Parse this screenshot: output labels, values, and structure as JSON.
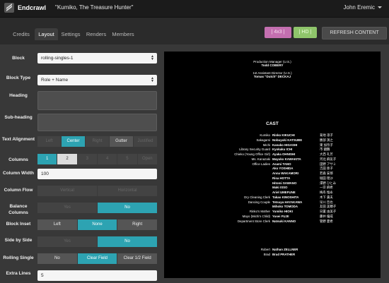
{
  "app": {
    "brand": "Endcrawl",
    "project": "\"Kumiko, The Treasure Hunter\"",
    "user": "John Eremic"
  },
  "tabs": [
    "Credits",
    "Layout",
    "Settings",
    "Renders",
    "Members"
  ],
  "active_tab": "Layout",
  "toolbar": {
    "ratio43": "| 4x3 |",
    "hd": "| HD |",
    "refresh": "REFRESH CONTENT"
  },
  "form": {
    "block": {
      "label": "Block",
      "value": "rolling-singles-1"
    },
    "block_type": {
      "label": "Block Type",
      "value": "Role + Name"
    },
    "heading": {
      "label": "Heading"
    },
    "subheading": {
      "label": "Sub-heading"
    },
    "text_alignment": {
      "label": "Text Alignment",
      "options": [
        "Left",
        "Center",
        "Right",
        "Gutter",
        "Justified"
      ],
      "selected": "Center"
    },
    "columns": {
      "label": "Columns",
      "options": [
        "1",
        "2",
        "3",
        "4",
        "5",
        "Open"
      ],
      "selected": "1"
    },
    "column_width": {
      "label": "Column Width",
      "value": "100"
    },
    "column_flow": {
      "label": "Column Flow",
      "options": [
        "Vertical",
        "Horizontal"
      ]
    },
    "balance_columns": {
      "label": "Balance Columns",
      "options": [
        "Yes",
        "No"
      ],
      "selected": "No"
    },
    "block_inset": {
      "label": "Block Inset",
      "options": [
        "Left",
        "None",
        "Right"
      ],
      "selected": "None"
    },
    "side_by_side": {
      "label": "Side by Side",
      "options": [
        "Yes",
        "No"
      ],
      "selected": "No"
    },
    "rolling_single": {
      "label": "Rolling Single",
      "options": [
        "No",
        "Clear Field",
        "Clear 1/2 Field"
      ],
      "selected": "Clear Field"
    },
    "extra_lines": {
      "label": "Extra Lines",
      "value": "5"
    }
  },
  "preview": {
    "top_credits": [
      {
        "role": "Production Manager (U.S.)",
        "name": "Todd COBERY"
      },
      {
        "role": "1st Assistant Director (U.S.)",
        "name": "Tomas \"Dutch\" DECKAJ"
      }
    ],
    "cast_heading": "CAST",
    "cast": [
      {
        "role": "Kumiko",
        "name": "Rinko KIKUCHI",
        "kanji": "菊地 凛子"
      },
      {
        "role": "Sakagami",
        "name": "Nobuyuki KATSUBE",
        "kanji": "勝部 演之"
      },
      {
        "role": "Michi",
        "name": "Kanako HIGASHI",
        "kanji": "東 加奈子"
      },
      {
        "role": "Library Security Guard",
        "name": "Kyokaku ICHI",
        "kanji": "市 鏡鶴"
      },
      {
        "role": "Chieko (Young Office Girl)",
        "name": "Ayaka OHNISHI",
        "kanji": "大西 礼芳"
      },
      {
        "role": "Ms. Kanazaki",
        "name": "Mayuko KAWAKITA",
        "kanji": "河北 麻友子"
      },
      {
        "role": "Office Ladies",
        "name": "Asami TANO",
        "kanji": "田野 アサミ"
      },
      {
        "role": "",
        "name": "Ako YOSHIDA",
        "kanji": "吉田 亜子"
      },
      {
        "role": "",
        "name": "Anna WAKAMORI",
        "kanji": "若森 安那"
      },
      {
        "role": "",
        "name": "Risa HOTTA",
        "kanji": "堀田 理沙"
      },
      {
        "role": "",
        "name": "Hitomi SAWANO",
        "kanji": "澤野 ひとみ"
      },
      {
        "role": "",
        "name": "Maki ISSO",
        "kanji": "一宗 麻希"
      },
      {
        "role": "",
        "name": "Ariel UMEFUNE",
        "kanji": "梅舟 惟永"
      },
      {
        "role": "Dry Cleaning Clerk",
        "name": "Takao KINOSHITA",
        "kanji": "木下 貴夫"
      },
      {
        "role": "Dancing Couple",
        "name": "Tetsuya HAYAKAWA",
        "kanji": "早川 哲也"
      },
      {
        "role": "",
        "name": "Mihoko TOMODA",
        "kanji": "友田 美穂子"
      },
      {
        "role": "Rinko's Mother",
        "name": "Yumiko HIOKI",
        "kanji": "日置 由美子"
      },
      {
        "role": "Mayo (Michi's Child)",
        "name": "Yusei FUJII",
        "kanji": "藤井 優成"
      },
      {
        "role": "Department Store Clerk",
        "name": "Natsuki KANNO",
        "kanji": "管野 夏希"
      }
    ],
    "bottom_credits": [
      {
        "role": "Robert",
        "name": "Nathan ZELLNER"
      },
      {
        "role": "Brad",
        "name": "Brad PRATHER"
      }
    ]
  }
}
